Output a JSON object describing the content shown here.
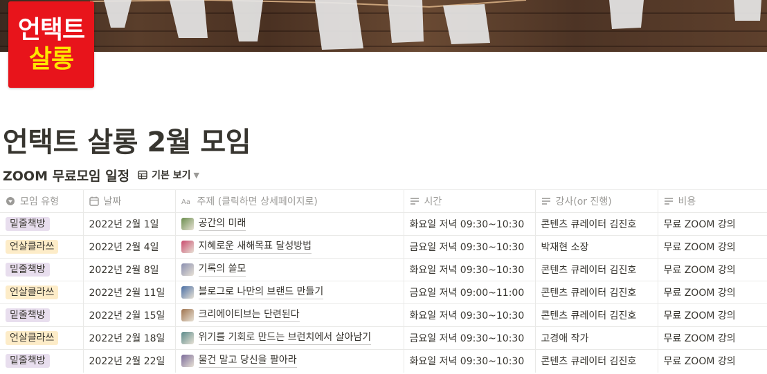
{
  "logo": {
    "line1": "언택트",
    "line2": "살롱"
  },
  "page": {
    "title": "언택트 살롱 2월 모임"
  },
  "database": {
    "title": "ZOOM 무료모임 일정",
    "view_label": "기본 보기",
    "columns": [
      {
        "label": "모임 유형",
        "icon": "select-icon"
      },
      {
        "label": "날짜",
        "icon": "calendar-icon"
      },
      {
        "label": "주제 (클릭하면 상세페이지로)",
        "icon": "text-aa-icon"
      },
      {
        "label": "시간",
        "icon": "text-lines-icon"
      },
      {
        "label": "강사(or 진행)",
        "icon": "text-lines-icon"
      },
      {
        "label": "비용",
        "icon": "text-lines-icon"
      }
    ],
    "rows": [
      {
        "type": "밑줄책방",
        "type_color": "#e8deee",
        "date": "2022년 2월 1일",
        "topic": "공간의 미래",
        "icon_color": "#6b8e4e",
        "time": "화요일 저녁 09:30~10:30",
        "instructor": "콘텐츠 큐레이터 김진호",
        "cost": "무료 ZOOM 강의"
      },
      {
        "type": "언살클라쓰",
        "type_color": "#fdecc8",
        "date": "2022년 2월 4일",
        "topic": "지혜로운 새해목표 달성방법",
        "icon_color": "#c94b6d",
        "time": "금요일 저녁 09:30~10:30",
        "instructor": "박재현 소장",
        "cost": "무료 ZOOM 강의"
      },
      {
        "type": "밑줄책방",
        "type_color": "#e8deee",
        "date": "2022년 2월 8일",
        "topic": "기록의 쓸모",
        "icon_color": "#8a8fb0",
        "time": "화요일 저녁 09:30~10:30",
        "instructor": "콘텐츠 큐레이터 김진호",
        "cost": "무료 ZOOM 강의"
      },
      {
        "type": "언살클라쓰",
        "type_color": "#fdecc8",
        "date": "2022년 2월 11일",
        "topic": "블로그로 나만의 브랜드 만들기",
        "icon_color": "#4a6fa5",
        "time": "금요일 저녁 09:00~11:00",
        "instructor": "콘텐츠 큐레이터 김진호",
        "cost": "무료 ZOOM 강의"
      },
      {
        "type": "밑줄책방",
        "type_color": "#e8deee",
        "date": "2022년 2월 15일",
        "topic": "크리에이티브는 단련된다",
        "icon_color": "#a0744f",
        "time": "화요일 저녁 09:30~10:30",
        "instructor": "콘텐츠 큐레이터 김진호",
        "cost": "무료 ZOOM 강의"
      },
      {
        "type": "언살클라쓰",
        "type_color": "#fdecc8",
        "date": "2022년 2월 18일",
        "topic": "위기를 기회로 만드는 브런치에서 살아남기",
        "icon_color": "#5a8a8a",
        "time": "금요일 저녁 09:30~10:30",
        "instructor": "고경애 작가",
        "cost": "무료 ZOOM 강의"
      },
      {
        "type": "밑줄책방",
        "type_color": "#e8deee",
        "date": "2022년 2월 22일",
        "topic": "물건 말고 당신을 팔아라",
        "icon_color": "#7a6a9a",
        "time": "화요일 저녁 09:30~10:30",
        "instructor": "콘텐츠 큐레이터 김진호",
        "cost": "무료 ZOOM 강의"
      }
    ]
  },
  "colors": {
    "logo_bg": "#e8141b",
    "logo_line2": "#ffe600",
    "text": "#37352f",
    "muted": "#9b9a97",
    "border": "#e9e9e7"
  }
}
